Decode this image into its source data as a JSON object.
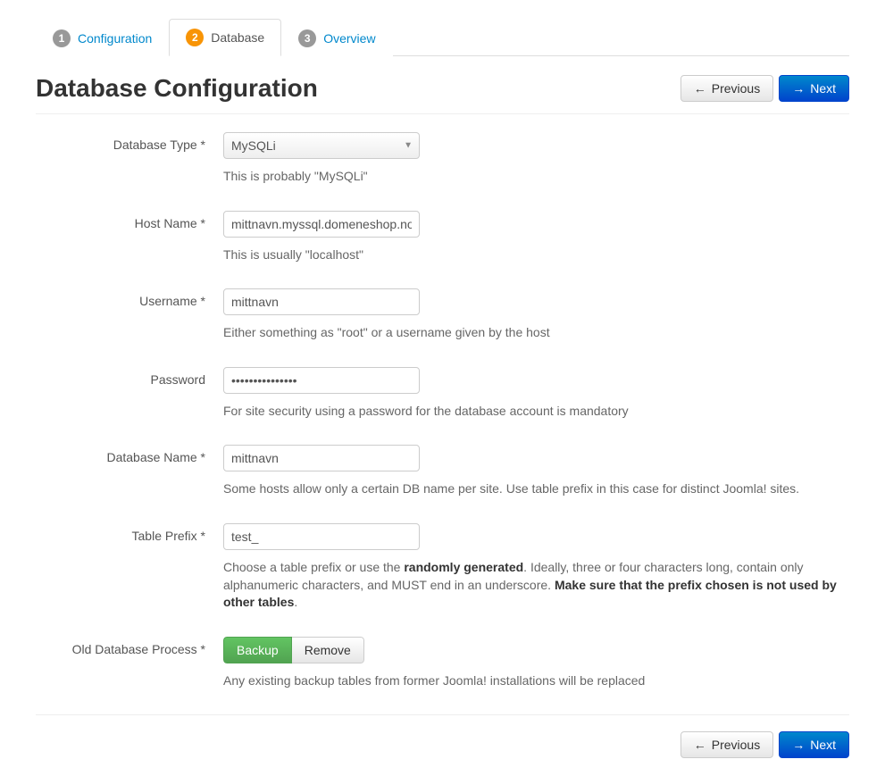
{
  "tabs": [
    {
      "num": "1",
      "label": "Configuration"
    },
    {
      "num": "2",
      "label": "Database"
    },
    {
      "num": "3",
      "label": "Overview"
    }
  ],
  "title": "Database Configuration",
  "buttons": {
    "previous": "Previous",
    "next": "Next"
  },
  "fields": {
    "db_type": {
      "label": "Database Type *",
      "value": "MySQLi",
      "help": "This is probably \"MySQLi\""
    },
    "host": {
      "label": "Host Name *",
      "value": "mittnavn.myssql.domeneshop.no",
      "help": "This is usually \"localhost\""
    },
    "username": {
      "label": "Username *",
      "value": "mittnavn",
      "help": "Either something as \"root\" or a username given by the host"
    },
    "password": {
      "label": "Password",
      "value": "•••••••••••••••",
      "help": "For site security using a password for the database account is mandatory"
    },
    "db_name": {
      "label": "Database Name *",
      "value": "mittnavn",
      "help": "Some hosts allow only a certain DB name per site. Use table prefix in this case for distinct Joomla! sites."
    },
    "prefix": {
      "label": "Table Prefix *",
      "value": "test_",
      "help_pre": "Choose a table prefix or use the ",
      "help_bold1": "randomly generated",
      "help_mid": ". Ideally, three or four characters long, contain only alphanumeric characters, and MUST end in an underscore. ",
      "help_bold2": "Make sure that the prefix chosen is not used by other tables",
      "help_post": "."
    },
    "old_db": {
      "label": "Old Database Process *",
      "backup": "Backup",
      "remove": "Remove",
      "help": "Any existing backup tables from former Joomla! installations will be replaced"
    }
  }
}
